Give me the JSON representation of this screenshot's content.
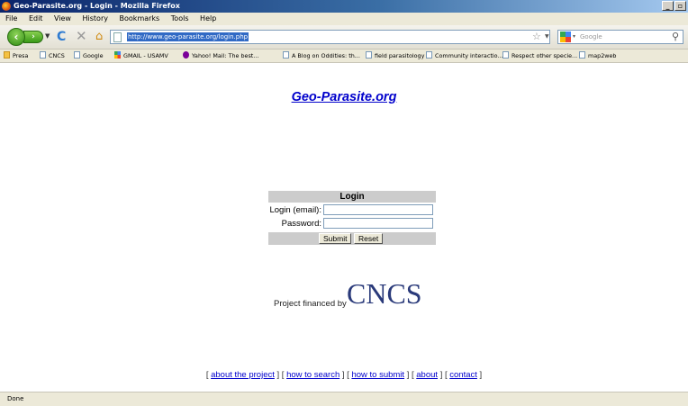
{
  "window": {
    "title": "Geo-Parasite.org - Login - Mozilla Firefox",
    "controls": [
      "_",
      "̅̅"
    ]
  },
  "menu": [
    "File",
    "Edit",
    "View",
    "History",
    "Bookmarks",
    "Tools",
    "Help"
  ],
  "navbar": {
    "url": "http://www.geo-parasite.org/login.php",
    "search_placeholder": "Google",
    "icons": [
      "back-icon",
      "forward-icon",
      "reload-icon",
      "stop-icon",
      "home-icon",
      "bookmark-star-icon"
    ]
  },
  "bookmarks": [
    {
      "label": "Presa",
      "icon": "folder"
    },
    {
      "label": "CNCS",
      "icon": "page"
    },
    {
      "label": "Google",
      "icon": "page"
    },
    {
      "label": "GMAIL - USAMV",
      "icon": "google"
    },
    {
      "label": "Yahoo! Mail: The best...",
      "icon": "yahoo"
    },
    {
      "label": "A Blog on Oddities: th...",
      "icon": "page"
    },
    {
      "label": "field parasitology",
      "icon": "page"
    },
    {
      "label": "Community interactio...",
      "icon": "page"
    },
    {
      "label": "Respect other specie...",
      "icon": "page"
    },
    {
      "label": "map2web",
      "icon": "page"
    }
  ],
  "page": {
    "site_title": "Geo-Parasite.org",
    "login": {
      "header": "Login",
      "email_label": "Login (email):",
      "password_label": "Password:",
      "submit_label": "Submit",
      "reset_label": "Reset"
    },
    "financed_text": "Project financed by",
    "logo_text": "CNCS",
    "footer": {
      "open": "[",
      "sep": "] [",
      "close": "]",
      "links": [
        "about the project",
        "how to search",
        "how to submit",
        "about",
        "contact"
      ]
    }
  },
  "status": "Done"
}
